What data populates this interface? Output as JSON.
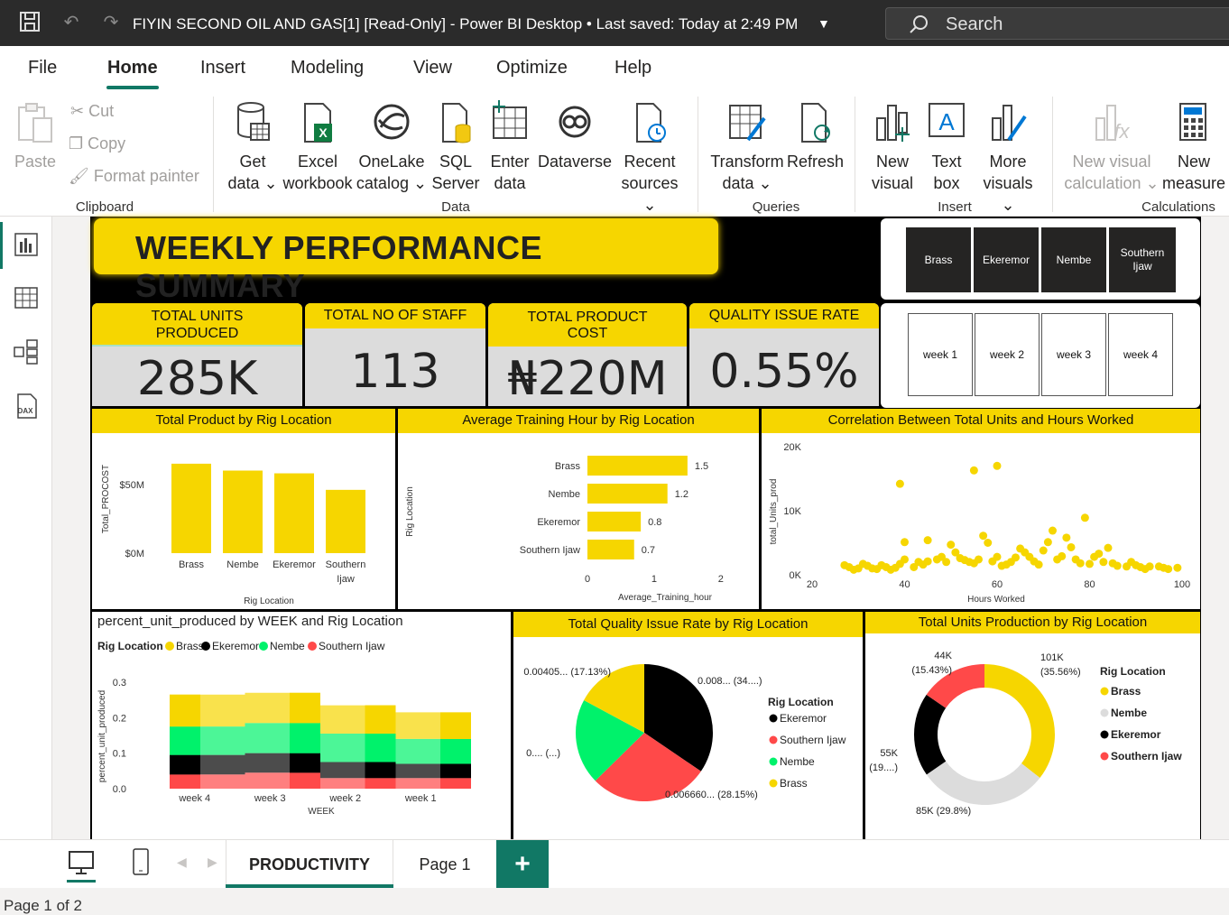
{
  "titlebar": {
    "title": "FIYIN SECOND OIL AND GAS[1] [Read-Only] - Power BI Desktop  •  Last saved: Today at 2:49 PM",
    "search_label": "Search"
  },
  "menu": {
    "tabs": [
      "File",
      "Home",
      "Insert",
      "Modeling",
      "View",
      "Optimize",
      "Help"
    ],
    "active": "Home"
  },
  "ribbon": {
    "clipboard": {
      "paste": "Paste",
      "cut": "Cut",
      "copy": "Copy",
      "format_painter": "Format painter",
      "group": "Clipboard"
    },
    "data": {
      "get_data": [
        "Get",
        "data ⌄"
      ],
      "excel": [
        "Excel",
        "workbook"
      ],
      "onelake": [
        "OneLake",
        "catalog ⌄"
      ],
      "sql": [
        "SQL",
        "Server"
      ],
      "enter": [
        "Enter",
        "data"
      ],
      "dataverse": [
        "Dataverse",
        ""
      ],
      "recent": [
        "Recent",
        "sources ⌄"
      ],
      "group": "Data"
    },
    "queries": {
      "transform": [
        "Transform",
        "data ⌄"
      ],
      "refresh": [
        "Refresh",
        ""
      ],
      "group": "Queries"
    },
    "insert": {
      "new_visual": [
        "New",
        "visual"
      ],
      "text_box": [
        "Text",
        "box"
      ],
      "more_visuals": [
        "More",
        "visuals ⌄"
      ],
      "group": "Insert"
    },
    "calculations": {
      "new_visual_calc": [
        "New visual",
        "calculation ⌄"
      ],
      "new_measure": [
        "New",
        "measure"
      ],
      "group": "Calculations"
    }
  },
  "report": {
    "title": "WEEKLY PERFORMANCE SUMMARY",
    "rig_slicer": [
      "Brass",
      "Ekeremor",
      "Nembe",
      "Southern Ijaw"
    ],
    "week_slicer": [
      "week 1",
      "week 2",
      "week 3",
      "week 4"
    ],
    "kpis": [
      {
        "label": "TOTAL UNITS PRODUCED",
        "value": "285K"
      },
      {
        "label": "TOTAL NO OF STAFF",
        "value": "113"
      },
      {
        "label": "TOTAL PRODUCT COST",
        "value": "₦220M"
      },
      {
        "label": "QUALITY ISSUE RATE",
        "value": "0.55%"
      }
    ]
  },
  "colors": {
    "yellow": "#f6d600",
    "black": "#000000",
    "green": "#00f26b",
    "red": "#ff4949",
    "grey": "#dcdcdc",
    "accent": "#117865"
  },
  "chart_data": [
    {
      "type": "bar",
      "title": "Total Product by Rig Location",
      "categories": [
        "Brass",
        "Nembe",
        "Ekeremor",
        "Southern Ijaw"
      ],
      "values": [
        65,
        60,
        58,
        46
      ],
      "xlabel": "Rig Location",
      "ylabel": "Total_PROCOST",
      "yticks": [
        "$0M",
        "$50M"
      ],
      "ylim": [
        0,
        80
      ]
    },
    {
      "type": "bar",
      "orientation": "horizontal",
      "title": "Average Training Hour by Rig Location",
      "categories": [
        "Brass",
        "Nembe",
        "Ekeremor",
        "Southern Ijaw"
      ],
      "values": [
        1.5,
        1.2,
        0.8,
        0.7
      ],
      "xlabel": "Average_Training_hour",
      "ylabel": "Rig Location",
      "xticks": [
        0,
        1,
        2
      ],
      "xlim": [
        0,
        2.3
      ]
    },
    {
      "type": "scatter",
      "title": "Correlation Between Total Units and Hours Worked",
      "xlabel": "Hours Worked",
      "ylabel": "total_Units_prod",
      "xticks": [
        20,
        40,
        60,
        80,
        100
      ],
      "yticks": [
        "0K",
        "10K",
        "20K"
      ],
      "xlim": [
        20,
        100
      ],
      "ylim": [
        0,
        20000
      ],
      "points": [
        [
          27,
          1500
        ],
        [
          28,
          1200
        ],
        [
          29,
          800
        ],
        [
          30,
          1000
        ],
        [
          31,
          1700
        ],
        [
          32,
          1400
        ],
        [
          33,
          1000
        ],
        [
          34,
          900
        ],
        [
          35,
          1500
        ],
        [
          36,
          1200
        ],
        [
          37,
          800
        ],
        [
          38,
          1100
        ],
        [
          39,
          1700
        ],
        [
          40,
          2400
        ],
        [
          40,
          5100
        ],
        [
          42,
          1200
        ],
        [
          43,
          2000
        ],
        [
          44,
          1600
        ],
        [
          45,
          2100
        ],
        [
          47,
          2400
        ],
        [
          48,
          2800
        ],
        [
          49,
          2000
        ],
        [
          50,
          4700
        ],
        [
          51,
          3500
        ],
        [
          52,
          2600
        ],
        [
          53,
          2300
        ],
        [
          54,
          2000
        ],
        [
          55,
          1800
        ],
        [
          56,
          2400
        ],
        [
          57,
          6100
        ],
        [
          58,
          5000
        ],
        [
          59,
          2100
        ],
        [
          60,
          2800
        ],
        [
          61,
          1400
        ],
        [
          62,
          1600
        ],
        [
          63,
          2000
        ],
        [
          64,
          2700
        ],
        [
          65,
          4100
        ],
        [
          66,
          3500
        ],
        [
          67,
          2800
        ],
        [
          68,
          2100
        ],
        [
          69,
          1600
        ],
        [
          70,
          3800
        ],
        [
          71,
          5100
        ],
        [
          72,
          6900
        ],
        [
          73,
          2400
        ],
        [
          74,
          2900
        ],
        [
          75,
          5800
        ],
        [
          76,
          4300
        ],
        [
          77,
          2400
        ],
        [
          78,
          1800
        ],
        [
          79,
          8900
        ],
        [
          80,
          1700
        ],
        [
          81,
          2800
        ],
        [
          82,
          3300
        ],
        [
          83,
          2000
        ],
        [
          84,
          4200
        ],
        [
          85,
          1800
        ],
        [
          86,
          1400
        ],
        [
          88,
          1300
        ],
        [
          89,
          2000
        ],
        [
          90,
          1500
        ],
        [
          91,
          1200
        ],
        [
          92,
          900
        ],
        [
          93,
          1300
        ],
        [
          95,
          1300
        ],
        [
          96,
          1100
        ],
        [
          97,
          900
        ],
        [
          99,
          1100
        ],
        [
          55,
          16300
        ],
        [
          60,
          17000
        ],
        [
          39,
          14200
        ],
        [
          45,
          5400
        ]
      ]
    },
    {
      "type": "area",
      "stacked": true,
      "title": "percent_unit_produced by WEEK and Rig Location",
      "legend_title": "Rig Location",
      "xlabel": "WEEK",
      "ylabel": "percent_unit_produced",
      "categories": [
        "week 4",
        "week 3",
        "week 2",
        "week 1"
      ],
      "yticks": [
        "0.0",
        "0.1",
        "0.2",
        "0.3"
      ],
      "ylim": [
        0,
        0.3
      ],
      "series": [
        {
          "name": "Southern Ijaw",
          "values": [
            0.04,
            0.045,
            0.03,
            0.03
          ]
        },
        {
          "name": "Ekeremor",
          "values": [
            0.055,
            0.055,
            0.045,
            0.04
          ]
        },
        {
          "name": "Nembe",
          "values": [
            0.08,
            0.085,
            0.08,
            0.07
          ]
        },
        {
          "name": "Brass",
          "values": [
            0.09,
            0.085,
            0.08,
            0.075
          ]
        }
      ]
    },
    {
      "type": "pie",
      "title": "Total Quality Issue Rate by Rig Location",
      "legend_title": "Rig Location",
      "slices": [
        {
          "name": "Ekeremor",
          "value": 34.5,
          "label": "0.008... (34....)"
        },
        {
          "name": "Southern Ijaw",
          "value": 28.15,
          "label": "0.006660... (28.15%)"
        },
        {
          "name": "Nembe",
          "value": 20.2,
          "label": "0.... (...)"
        },
        {
          "name": "Brass",
          "value": 17.13,
          "label": "0.00405... (17.13%)"
        }
      ]
    },
    {
      "type": "pie",
      "donut": true,
      "title": "Total Units Production by Rig Location",
      "legend_title": "Rig Location",
      "slices": [
        {
          "name": "Brass",
          "value": 35.56,
          "label": "101K (35.56%)"
        },
        {
          "name": "Nembe",
          "value": 29.8,
          "label": "85K (29.8%)"
        },
        {
          "name": "Ekeremor",
          "value": 19.21,
          "label": "55K (19....)"
        },
        {
          "name": "Southern Ijaw",
          "value": 15.43,
          "label": "44K (15.43%)"
        }
      ]
    }
  ],
  "pages": {
    "tabs": [
      "PRODUCTIVITY",
      "Page 1"
    ],
    "active": "PRODUCTIVITY",
    "add": "+"
  },
  "status": "Page 1 of 2"
}
